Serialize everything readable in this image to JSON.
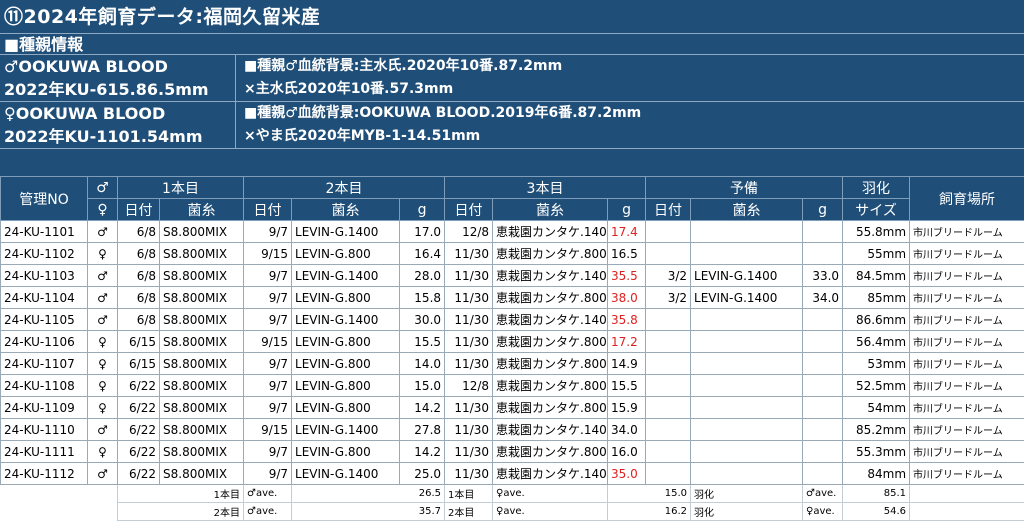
{
  "title": "⑪2024年飼育データ:福岡久留米産",
  "section": "■種親情報",
  "male_parent": {
    "line1": "♂OOKUWA BLOOD",
    "line2": "2022年KU-615.86.5mm",
    "info1": "■種親♂血統背景:主水氏.2020年10番.87.2mm",
    "info2": "×主水氏2020年10番.57.3mm"
  },
  "female_parent": {
    "line1": "♀OOKUWA BLOOD",
    "line2": "2022年KU-1101.54mm",
    "info1": "■種親♂血統背景:OOKUWA BLOOD.2019年6番.87.2mm",
    "info2": "×やま氏2020年MYB-1-14.51mm"
  },
  "headers": {
    "row1": {
      "no": "管理NO",
      "sex": "♂",
      "first": "1本目",
      "second": "2本目",
      "third": "3本目",
      "spare": "予備",
      "eclosion": "羽化",
      "place": "飼育場所"
    },
    "row2": {
      "sex": "♀",
      "date": "日付",
      "fungus": "菌糸",
      "g": "g",
      "size": "サイズ"
    }
  },
  "rows": [
    {
      "no": "24-KU-1101",
      "sex": "♂",
      "d1": "6/8",
      "f1": "S8.800MIX",
      "d2": "9/7",
      "f2": "LEVIN-G.1400",
      "g2": "17.0",
      "d3": "12/8",
      "f3": "恵栽園カンタケ.1400",
      "g3": "17.4",
      "g3red": true,
      "d4": "",
      "f4": "",
      "g4": "",
      "size": "55.8mm",
      "place": "市川ブリードルーム"
    },
    {
      "no": "24-KU-1102",
      "sex": "♀",
      "d1": "6/8",
      "f1": "S8.800MIX",
      "d2": "9/15",
      "f2": "LEVIN-G.800",
      "g2": "16.4",
      "d3": "11/30",
      "f3": "恵栽園カンタケ.800",
      "g3": "16.5",
      "g3red": false,
      "d4": "",
      "f4": "",
      "g4": "",
      "size": "55mm",
      "place": "市川ブリードルーム"
    },
    {
      "no": "24-KU-1103",
      "sex": "♂",
      "d1": "6/8",
      "f1": "S8.800MIX",
      "d2": "9/7",
      "f2": "LEVIN-G.1400",
      "g2": "28.0",
      "d3": "11/30",
      "f3": "恵栽園カンタケ.1400",
      "g3": "35.5",
      "g3red": true,
      "d4": "3/2",
      "f4": "LEVIN-G.1400",
      "g4": "33.0",
      "size": "84.5mm",
      "place": "市川ブリードルーム"
    },
    {
      "no": "24-KU-1104",
      "sex": "♂",
      "d1": "6/8",
      "f1": "S8.800MIX",
      "d2": "9/7",
      "f2": "LEVIN-G.800",
      "g2": "15.8",
      "d3": "11/30",
      "f3": "恵栽園カンタケ.800",
      "g3": "38.0",
      "g3red": true,
      "d4": "3/2",
      "f4": "LEVIN-G.1400",
      "g4": "34.0",
      "size": "85mm",
      "place": "市川ブリードルーム"
    },
    {
      "no": "24-KU-1105",
      "sex": "♂",
      "d1": "6/8",
      "f1": "S8.800MIX",
      "d2": "9/7",
      "f2": "LEVIN-G.1400",
      "g2": "30.0",
      "d3": "11/30",
      "f3": "恵栽園カンタケ.1400",
      "g3": "35.8",
      "g3red": true,
      "d4": "",
      "f4": "",
      "g4": "",
      "size": "86.6mm",
      "place": "市川ブリードルーム"
    },
    {
      "no": "24-KU-1106",
      "sex": "♀",
      "d1": "6/15",
      "f1": "S8.800MIX",
      "d2": "9/15",
      "f2": "LEVIN-G.800",
      "g2": "15.5",
      "d3": "11/30",
      "f3": "恵栽園カンタケ.800",
      "g3": "17.2",
      "g3red": true,
      "d4": "",
      "f4": "",
      "g4": "",
      "size": "56.4mm",
      "place": "市川ブリードルーム"
    },
    {
      "no": "24-KU-1107",
      "sex": "♀",
      "d1": "6/15",
      "f1": "S8.800MIX",
      "d2": "9/7",
      "f2": "LEVIN-G.800",
      "g2": "14.0",
      "d3": "11/30",
      "f3": "恵栽園カンタケ.800",
      "g3": "14.9",
      "g3red": false,
      "d4": "",
      "f4": "",
      "g4": "",
      "size": "53mm",
      "place": "市川ブリードルーム"
    },
    {
      "no": "24-KU-1108",
      "sex": "♀",
      "d1": "6/22",
      "f1": "S8.800MIX",
      "d2": "9/7",
      "f2": "LEVIN-G.800",
      "g2": "15.0",
      "d3": "12/8",
      "f3": "恵栽園カンタケ.800",
      "g3": "15.5",
      "g3red": false,
      "d4": "",
      "f4": "",
      "g4": "",
      "size": "52.5mm",
      "place": "市川ブリードルーム"
    },
    {
      "no": "24-KU-1109",
      "sex": "♀",
      "d1": "6/22",
      "f1": "S8.800MIX",
      "d2": "9/7",
      "f2": "LEVIN-G.800",
      "g2": "14.2",
      "d3": "11/30",
      "f3": "恵栽園カンタケ.800",
      "g3": "15.9",
      "g3red": false,
      "d4": "",
      "f4": "",
      "g4": "",
      "size": "54mm",
      "place": "市川ブリードルーム"
    },
    {
      "no": "24-KU-1110",
      "sex": "♂",
      "d1": "6/22",
      "f1": "S8.800MIX",
      "d2": "9/15",
      "f2": "LEVIN-G.1400",
      "g2": "27.8",
      "d3": "11/30",
      "f3": "恵栽園カンタケ.1400",
      "g3": "34.0",
      "g3red": false,
      "d4": "",
      "f4": "",
      "g4": "",
      "size": "85.2mm",
      "place": "市川ブリードルーム"
    },
    {
      "no": "24-KU-1111",
      "sex": "♀",
      "d1": "6/22",
      "f1": "S8.800MIX",
      "d2": "9/7",
      "f2": "LEVIN-G.800",
      "g2": "14.2",
      "d3": "11/30",
      "f3": "恵栽園カンタケ.800",
      "g3": "16.0",
      "g3red": false,
      "d4": "",
      "f4": "",
      "g4": "",
      "size": "55.3mm",
      "place": "市川ブリードルーム"
    },
    {
      "no": "24-KU-1112",
      "sex": "♂",
      "d1": "6/22",
      "f1": "S8.800MIX",
      "d2": "9/7",
      "f2": "LEVIN-G.1400",
      "g2": "25.0",
      "d3": "11/30",
      "f3": "恵栽園カンタケ.1400",
      "g3": "35.0",
      "g3red": true,
      "d4": "",
      "f4": "",
      "g4": "",
      "size": "84mm",
      "place": "市川ブリードルーム"
    }
  ],
  "summary": [
    {
      "label1": "1本目",
      "ave1": "♂ave.",
      "val1": "26.5",
      "label2": "1本目",
      "ave2": "♀ave.",
      "val2": "15.0",
      "label3": "羽化",
      "ave3": "♂ave.",
      "val3": "85.1"
    },
    {
      "label1": "2本目",
      "ave1": "♂ave.",
      "val1": "35.7",
      "label2": "2本目",
      "ave2": "♀ave.",
      "val2": "16.2",
      "label3": "羽化",
      "ave3": "♀ave.",
      "val3": "54.6"
    }
  ],
  "colors": {
    "header_bg": "#1f4e78",
    "highlight": "#e02020"
  }
}
